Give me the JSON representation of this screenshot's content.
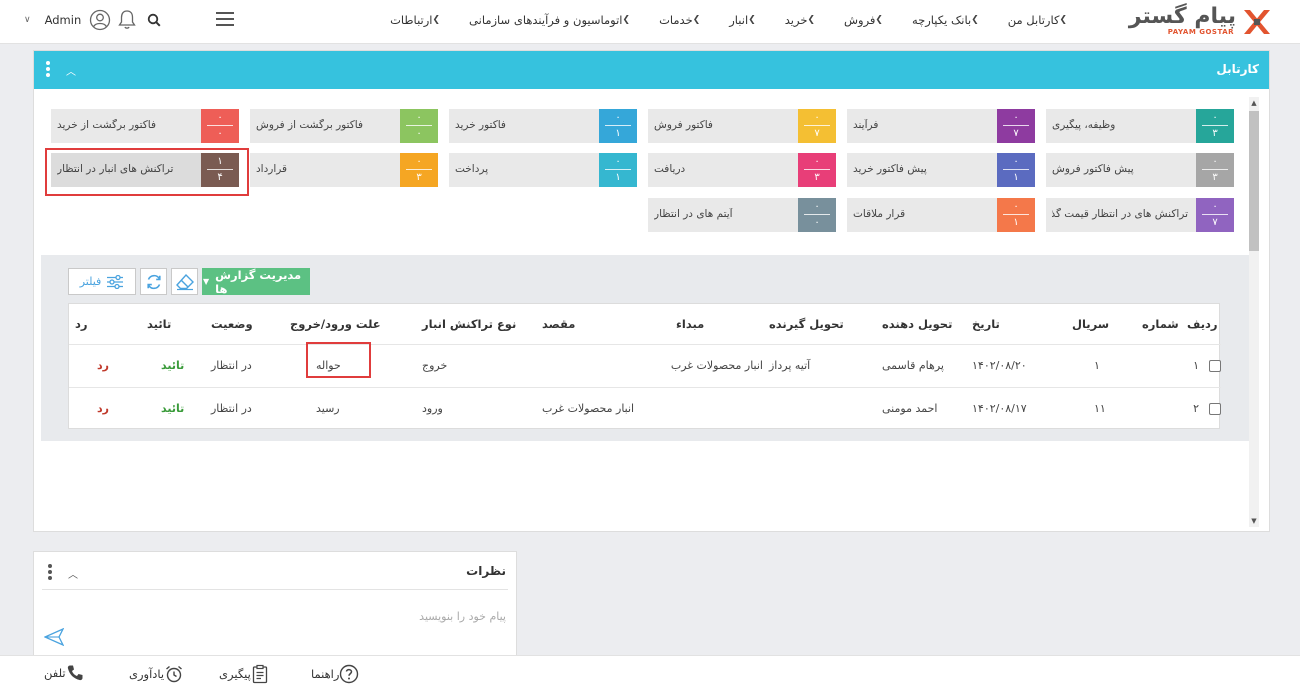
{
  "brand": {
    "name_fa": "پیام گستر",
    "name_en": "PAYAM GOSTAR",
    "accent": "#e2542f"
  },
  "nav": [
    {
      "label": "کارتابل من"
    },
    {
      "label": "بانک یکپارچه"
    },
    {
      "label": "فروش"
    },
    {
      "label": "خرید"
    },
    {
      "label": "انبار"
    },
    {
      "label": "خدمات"
    },
    {
      "label": "اتوماسیون و فرآیندهای سازمانی"
    },
    {
      "label": "ارتباطات"
    }
  ],
  "user": {
    "name": "Admin"
  },
  "panel": {
    "title": "کارتابل",
    "header_color": "#36c2de"
  },
  "tiles": [
    {
      "label": "وظیفه، پیگیری",
      "top": "۰",
      "bottom": "۳",
      "color": "#26a69a"
    },
    {
      "label": "فرآیند",
      "top": "۰",
      "bottom": "۷",
      "color": "#8e3ba0"
    },
    {
      "label": "فاکتور فروش",
      "top": "۰",
      "bottom": "۷",
      "color": "#f4bf33"
    },
    {
      "label": "فاکتور خرید",
      "top": "۰",
      "bottom": "۱",
      "color": "#35a7d9"
    },
    {
      "label": "فاکتور برگشت از فروش",
      "top": "۰",
      "bottom": "۰",
      "color": "#8cc560"
    },
    {
      "label": "فاکتور برگشت از خرید",
      "top": "۰",
      "bottom": "۰",
      "color": "#ee5e57"
    },
    {
      "label": "پیش فاکتور فروش",
      "top": "۰",
      "bottom": "۳",
      "color": "#a6a6a6"
    },
    {
      "label": "پیش فاکتور خرید",
      "top": "۰",
      "bottom": "۱",
      "color": "#5b6bc0"
    },
    {
      "label": "دریافت",
      "top": "۰",
      "bottom": "۳",
      "color": "#e83e78"
    },
    {
      "label": "پرداخت",
      "top": "۰",
      "bottom": "۱",
      "color": "#35b7d0"
    },
    {
      "label": "قرارداد",
      "top": "۰",
      "bottom": "۳",
      "color": "#f5a623"
    },
    {
      "label": "تراکنش های انبار در انتظار",
      "top": "۱",
      "bottom": "۴",
      "color": "#7a5b52"
    },
    {
      "label": "تراکنش های در انتظار قیمت گذاری",
      "top": "۰",
      "bottom": "۷",
      "color": "#9064c0"
    },
    {
      "label": "قرار ملاقات",
      "top": "۰",
      "bottom": "۱",
      "color": "#f4784a"
    },
    {
      "label": "آیتم های در انتظار",
      "top": "۰",
      "bottom": "۰",
      "color": "#78909c"
    }
  ],
  "toolbar": {
    "manage_label": "مدیریت گزارش ها",
    "filter_label": "فیلتر"
  },
  "table": {
    "headers": {
      "row": "ردیف",
      "number": "شماره",
      "serial": "سریال",
      "date": "تاریخ",
      "deliverer": "تحویل دهنده",
      "receiver": "تحویل گیرنده",
      "origin": "مبداء",
      "destination": "مقصد",
      "type": "نوع تراکنش انبار",
      "reason": "علت ورود/خروج",
      "status": "وضعیت",
      "approve": "تائید",
      "reject": "رد"
    },
    "rows": [
      {
        "row": "۱",
        "number": "",
        "serial": "۱",
        "date": "۱۴۰۲/۰۸/۲۰",
        "deliverer": "پرهام قاسمی",
        "receiver": "آتیه پرداز",
        "origin": "انبار محصولات غرب",
        "destination": "",
        "type": "خروج",
        "reason": "حواله",
        "status": "در انتظار",
        "approve": "تائید",
        "reject": "رد"
      },
      {
        "row": "۲",
        "number": "",
        "serial": "۱۱",
        "date": "۱۴۰۲/۰۸/۱۷",
        "deliverer": "احمد مومنی",
        "receiver": "",
        "origin": "",
        "destination": "انبار محصولات غرب",
        "type": "ورود",
        "reason": "رسید",
        "status": "در انتظار",
        "approve": "تائید",
        "reject": "رد"
      }
    ]
  },
  "comments": {
    "title": "نظرات",
    "placeholder": "پیام خود را بنویسید"
  },
  "bottom_bar": [
    {
      "label": "تلفن",
      "icon": "phone-icon"
    },
    {
      "label": "یادآوری",
      "icon": "alarm-clock-icon"
    },
    {
      "label": "پیگیری",
      "icon": "clipboard-icon"
    },
    {
      "label": "راهنما",
      "icon": "help-icon"
    }
  ]
}
